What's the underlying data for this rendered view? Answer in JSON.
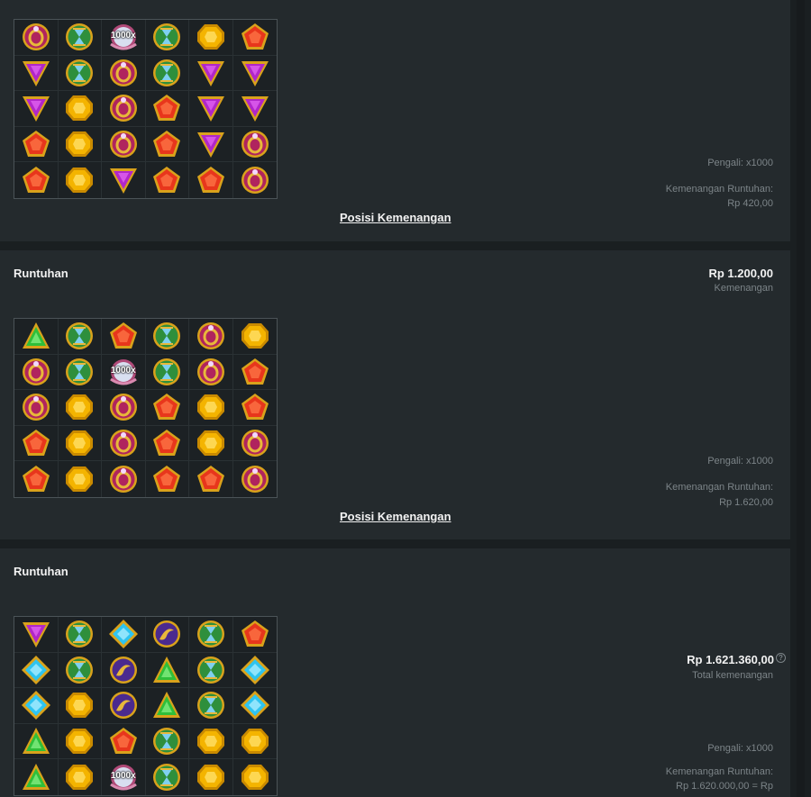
{
  "panels": [
    {
      "title": "",
      "grid": [
        [
          "ring",
          "hourglass",
          "multiplier",
          "hourglass",
          "yellow",
          "red"
        ],
        [
          "purple",
          "hourglass",
          "ring",
          "hourglass",
          "purple",
          "purple"
        ],
        [
          "purple",
          "yellow",
          "ring",
          "red",
          "purple",
          "purple"
        ],
        [
          "red",
          "yellow",
          "ring",
          "red",
          "purple",
          "ring"
        ],
        [
          "red",
          "yellow",
          "purple",
          "red",
          "red",
          "ring"
        ]
      ],
      "link": "Posisi Kemenangan",
      "multiplier_text": "Pengali: x1000",
      "cascade_label": "Kemenangan Runtuhan:",
      "cascade_value": "Rp 420,00"
    },
    {
      "title": "Runtuhan",
      "win_amount": "Rp 1.200,00",
      "win_label": "Kemenangan",
      "grid": [
        [
          "green",
          "hourglass",
          "red",
          "hourglass",
          "ring",
          "yellow"
        ],
        [
          "ring",
          "hourglass",
          "multiplier",
          "hourglass",
          "ring",
          "red"
        ],
        [
          "ring",
          "yellow",
          "ring",
          "red",
          "yellow",
          "red"
        ],
        [
          "red",
          "yellow",
          "ring",
          "red",
          "yellow",
          "ring"
        ],
        [
          "red",
          "yellow",
          "ring",
          "red",
          "red",
          "ring"
        ]
      ],
      "link": "Posisi Kemenangan",
      "multiplier_text": "Pengali: x1000",
      "cascade_label": "Kemenangan Runtuhan:",
      "cascade_value": "Rp 1.620,00"
    },
    {
      "title": "Runtuhan",
      "total_amount": "Rp 1.621.360,00",
      "total_label": "Total kemenangan",
      "help_glyph": "?",
      "grid": [
        [
          "purple",
          "hourglass",
          "blue",
          "amulet",
          "hourglass",
          "red"
        ],
        [
          "blue",
          "hourglass",
          "amulet",
          "green",
          "hourglass",
          "blue"
        ],
        [
          "blue",
          "yellow",
          "amulet",
          "green",
          "hourglass",
          "blue"
        ],
        [
          "green",
          "yellow",
          "red",
          "hourglass",
          "yellow",
          "yellow"
        ],
        [
          "green",
          "yellow",
          "multiplier",
          "hourglass",
          "yellow",
          "yellow"
        ]
      ],
      "multiplier_text": "Pengali: x1000",
      "cascade_label": "Kemenangan Runtuhan:",
      "cascade_value": "Rp 1.620.000,00 = Rp"
    }
  ],
  "multiplier_symbol_label": "1000x",
  "colors": {
    "panel": "#242a2d",
    "background": "#1a1f21",
    "muted_text": "#7c8488",
    "red_gem": "#e8361c",
    "yellow_gem": "#f4b400",
    "purple_gem": "#b126c9",
    "green_gem": "#2fbf3a",
    "blue_gem": "#2ec4f0",
    "ring_gem": "#b0245e"
  }
}
